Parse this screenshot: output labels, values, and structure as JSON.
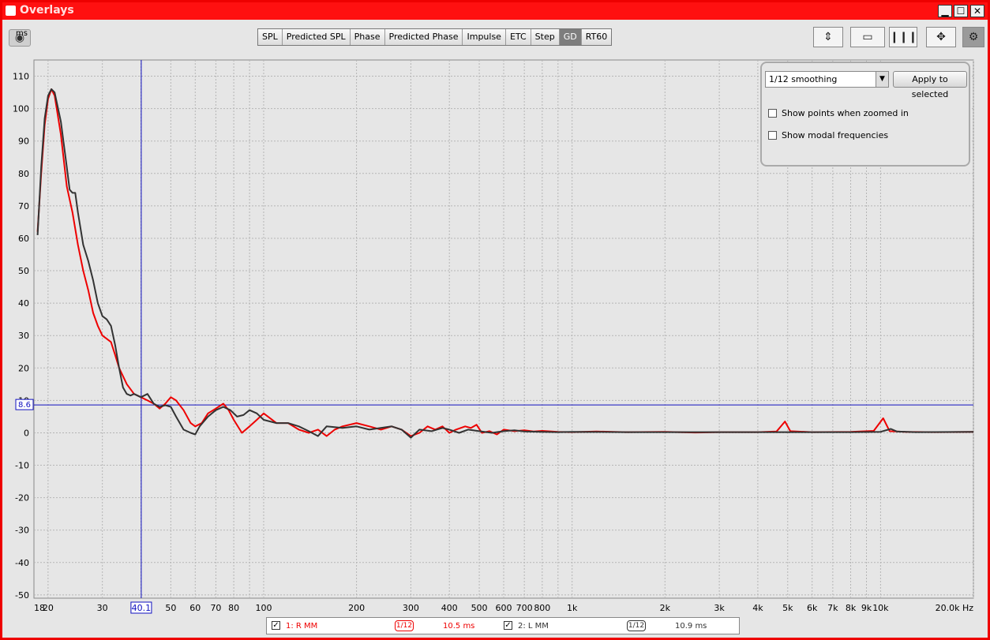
{
  "window": {
    "title": "Overlays",
    "min": "▁",
    "max": "☐",
    "close": "✕"
  },
  "toolbar": {
    "camera_icon": "camera-icon",
    "tabs": [
      "SPL",
      "Predicted SPL",
      "Phase",
      "Predicted Phase",
      "Impulse",
      "ETC",
      "Step",
      "GD",
      "RT60"
    ],
    "active_tab": "GD",
    "right_icons": [
      "vertical-zoom-icon",
      "graph-height-icon",
      "vertical-lines-icon",
      "pan-arrows-icon",
      "settings-gear-icon"
    ]
  },
  "panel": {
    "smoothing": "1/12 smoothing",
    "apply_label": "Apply to selected",
    "show_points": "Show points when zoomed in",
    "show_modal": "Show modal frequencies"
  },
  "colors": {
    "red": "#ee0000",
    "dark": "#333333",
    "cursor": "#1010c0"
  },
  "chart_data": {
    "type": "line",
    "ylabel": "ms",
    "xlabel": "Hz",
    "x_scale": "log",
    "xlim": [
      18,
      20000
    ],
    "ylim": [
      -51,
      115
    ],
    "grid": true,
    "y_ticks": [
      110,
      100,
      90,
      80,
      70,
      60,
      50,
      40,
      30,
      20,
      10,
      0,
      -10,
      -20,
      -30,
      -40,
      -50
    ],
    "x_ticks": [
      {
        "v": 18,
        "label": "18"
      },
      {
        "v": 20,
        "label": "20"
      },
      {
        "v": 30,
        "label": "30"
      },
      {
        "v": 50,
        "label": "50"
      },
      {
        "v": 60,
        "label": "60"
      },
      {
        "v": 70,
        "label": "70"
      },
      {
        "v": 80,
        "label": "80"
      },
      {
        "v": 100,
        "label": "100"
      },
      {
        "v": 200,
        "label": "200"
      },
      {
        "v": 300,
        "label": "300"
      },
      {
        "v": 400,
        "label": "400"
      },
      {
        "v": 500,
        "label": "500"
      },
      {
        "v": 600,
        "label": "600"
      },
      {
        "v": 700,
        "label": "700"
      },
      {
        "v": 800,
        "label": "800"
      },
      {
        "v": 1000,
        "label": "1k"
      },
      {
        "v": 2000,
        "label": "2k"
      },
      {
        "v": 3000,
        "label": "3k"
      },
      {
        "v": 4000,
        "label": "4k"
      },
      {
        "v": 5000,
        "label": "5k"
      },
      {
        "v": 6000,
        "label": "6k"
      },
      {
        "v": 7000,
        "label": "7k"
      },
      {
        "v": 8000,
        "label": "8k"
      },
      {
        "v": 9000,
        "label": "9k"
      },
      {
        "v": 10000,
        "label": "10k"
      },
      {
        "v": 20000,
        "label": "20.0k Hz"
      }
    ],
    "cursor": {
      "x": 40.1,
      "y": 8.6,
      "x_label": "40.1",
      "y_label": "8.6"
    },
    "series": [
      {
        "name": "1: R MM",
        "smoothing": "1/12",
        "value": "10.5 ms",
        "color": "#ee0000",
        "points": [
          [
            18.5,
            62
          ],
          [
            19,
            80
          ],
          [
            19.5,
            95
          ],
          [
            20,
            103
          ],
          [
            20.5,
            106
          ],
          [
            21,
            104
          ],
          [
            22,
            92
          ],
          [
            23,
            76
          ],
          [
            24,
            68
          ],
          [
            25,
            58
          ],
          [
            26,
            50
          ],
          [
            27,
            44
          ],
          [
            28,
            37
          ],
          [
            29,
            33
          ],
          [
            30,
            30
          ],
          [
            31,
            29
          ],
          [
            32,
            28
          ],
          [
            33,
            24
          ],
          [
            34,
            20
          ],
          [
            36,
            15
          ],
          [
            38,
            12
          ],
          [
            40,
            11
          ],
          [
            42,
            10
          ],
          [
            44,
            9
          ],
          [
            46,
            7.5
          ],
          [
            48,
            9
          ],
          [
            50,
            11
          ],
          [
            52,
            10
          ],
          [
            55,
            7
          ],
          [
            58,
            3
          ],
          [
            60,
            2
          ],
          [
            63,
            3
          ],
          [
            66,
            6
          ],
          [
            70,
            7.5
          ],
          [
            74,
            9
          ],
          [
            77,
            7
          ],
          [
            80,
            4
          ],
          [
            85,
            0
          ],
          [
            90,
            2
          ],
          [
            95,
            4
          ],
          [
            100,
            6
          ],
          [
            110,
            3
          ],
          [
            120,
            3
          ],
          [
            130,
            1
          ],
          [
            140,
            0
          ],
          [
            150,
            1
          ],
          [
            160,
            -1
          ],
          [
            170,
            1
          ],
          [
            180,
            2
          ],
          [
            200,
            3
          ],
          [
            220,
            2
          ],
          [
            240,
            1
          ],
          [
            260,
            2
          ],
          [
            280,
            1
          ],
          [
            300,
            -1
          ],
          [
            320,
            0
          ],
          [
            340,
            2
          ],
          [
            360,
            1
          ],
          [
            380,
            2
          ],
          [
            400,
            0
          ],
          [
            420,
            1
          ],
          [
            450,
            2
          ],
          [
            470,
            1.5
          ],
          [
            490,
            2.5
          ],
          [
            510,
            0
          ],
          [
            540,
            0.5
          ],
          [
            570,
            -0.5
          ],
          [
            600,
            1
          ],
          [
            650,
            0.5
          ],
          [
            700,
            0.8
          ],
          [
            750,
            0.4
          ],
          [
            800,
            0.6
          ],
          [
            900,
            0.3
          ],
          [
            1000,
            0.2
          ],
          [
            1200,
            0.4
          ],
          [
            1500,
            0.2
          ],
          [
            2000,
            0.3
          ],
          [
            2500,
            0.1
          ],
          [
            3000,
            0.2
          ],
          [
            4000,
            0.2
          ],
          [
            4600,
            0.4
          ],
          [
            4900,
            3.5
          ],
          [
            5100,
            0.5
          ],
          [
            6000,
            0.2
          ],
          [
            8000,
            0.3
          ],
          [
            9500,
            0.6
          ],
          [
            10200,
            4.5
          ],
          [
            10700,
            0.5
          ],
          [
            12000,
            0.3
          ],
          [
            15000,
            0.2
          ],
          [
            20000,
            0.3
          ]
        ]
      },
      {
        "name": "2: L MM",
        "smoothing": "1/12",
        "value": "10.9 ms",
        "color": "#333333",
        "points": [
          [
            18.5,
            61
          ],
          [
            19,
            82
          ],
          [
            19.5,
            97
          ],
          [
            20,
            104
          ],
          [
            20.5,
            106
          ],
          [
            21,
            105
          ],
          [
            22,
            96
          ],
          [
            23,
            82
          ],
          [
            23.5,
            75
          ],
          [
            24,
            74
          ],
          [
            24.5,
            74
          ],
          [
            25,
            68
          ],
          [
            26,
            58
          ],
          [
            27,
            53
          ],
          [
            28,
            47
          ],
          [
            29,
            40
          ],
          [
            30,
            36
          ],
          [
            31,
            35
          ],
          [
            32,
            33
          ],
          [
            33,
            27
          ],
          [
            34,
            20
          ],
          [
            35,
            14
          ],
          [
            36,
            12
          ],
          [
            37,
            11.5
          ],
          [
            38,
            12
          ],
          [
            40,
            11
          ],
          [
            42,
            12
          ],
          [
            44,
            9
          ],
          [
            46,
            8
          ],
          [
            48,
            8.5
          ],
          [
            50,
            8
          ],
          [
            52,
            5
          ],
          [
            55,
            1
          ],
          [
            58,
            0
          ],
          [
            60,
            -0.5
          ],
          [
            62,
            2
          ],
          [
            66,
            5
          ],
          [
            70,
            7
          ],
          [
            74,
            8
          ],
          [
            78,
            7
          ],
          [
            82,
            5
          ],
          [
            86,
            5.5
          ],
          [
            90,
            7
          ],
          [
            95,
            6
          ],
          [
            100,
            4
          ],
          [
            110,
            3
          ],
          [
            120,
            3
          ],
          [
            130,
            2
          ],
          [
            140,
            0.5
          ],
          [
            150,
            -1
          ],
          [
            160,
            2
          ],
          [
            180,
            1.5
          ],
          [
            200,
            2
          ],
          [
            220,
            1
          ],
          [
            240,
            1.5
          ],
          [
            260,
            2
          ],
          [
            280,
            1
          ],
          [
            300,
            -1.5
          ],
          [
            320,
            1
          ],
          [
            350,
            0.5
          ],
          [
            380,
            1.5
          ],
          [
            400,
            1
          ],
          [
            430,
            0
          ],
          [
            460,
            1
          ],
          [
            500,
            0.5
          ],
          [
            550,
            0
          ],
          [
            600,
            0.5
          ],
          [
            650,
            0.8
          ],
          [
            700,
            0.4
          ],
          [
            800,
            0.3
          ],
          [
            900,
            0.2
          ],
          [
            1000,
            0.3
          ],
          [
            1500,
            0.2
          ],
          [
            2000,
            0.2
          ],
          [
            3000,
            0.2
          ],
          [
            5000,
            0.2
          ],
          [
            8000,
            0.2
          ],
          [
            10000,
            0.3
          ],
          [
            10800,
            1.2
          ],
          [
            11300,
            0.4
          ],
          [
            13000,
            0.2
          ],
          [
            20000,
            0.3
          ]
        ]
      }
    ]
  }
}
